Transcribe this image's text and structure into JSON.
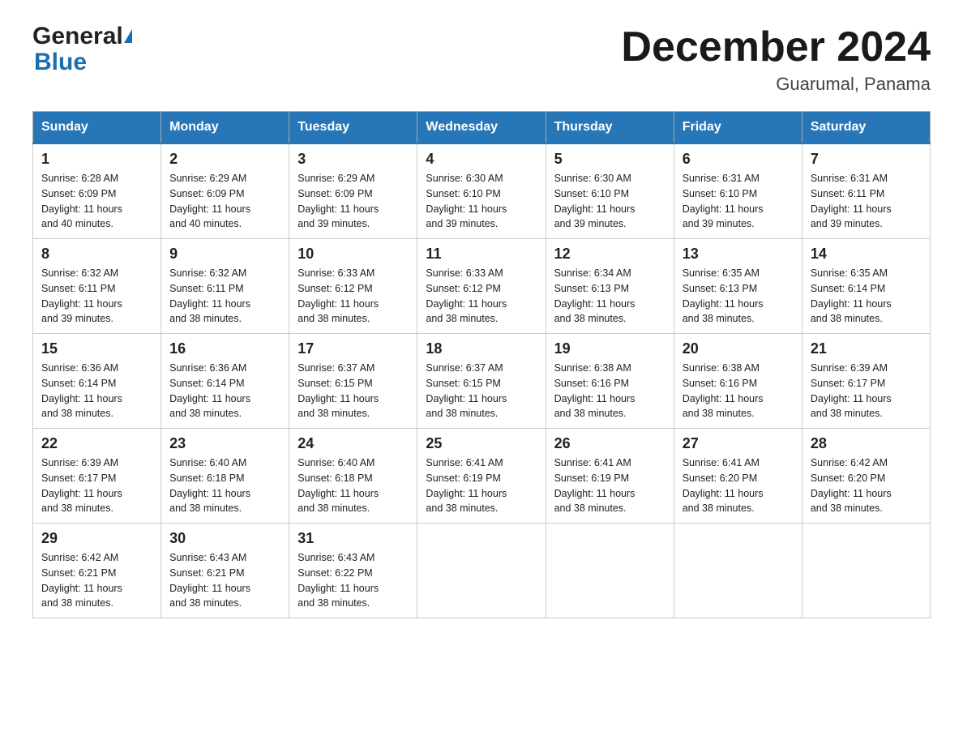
{
  "header": {
    "title": "December 2024",
    "subtitle": "Guarumal, Panama",
    "logo_general": "General",
    "logo_blue": "Blue"
  },
  "days_of_week": [
    "Sunday",
    "Monday",
    "Tuesday",
    "Wednesday",
    "Thursday",
    "Friday",
    "Saturday"
  ],
  "weeks": [
    [
      {
        "day": "1",
        "sunrise": "6:28 AM",
        "sunset": "6:09 PM",
        "daylight": "11 hours and 40 minutes."
      },
      {
        "day": "2",
        "sunrise": "6:29 AM",
        "sunset": "6:09 PM",
        "daylight": "11 hours and 40 minutes."
      },
      {
        "day": "3",
        "sunrise": "6:29 AM",
        "sunset": "6:09 PM",
        "daylight": "11 hours and 39 minutes."
      },
      {
        "day": "4",
        "sunrise": "6:30 AM",
        "sunset": "6:10 PM",
        "daylight": "11 hours and 39 minutes."
      },
      {
        "day": "5",
        "sunrise": "6:30 AM",
        "sunset": "6:10 PM",
        "daylight": "11 hours and 39 minutes."
      },
      {
        "day": "6",
        "sunrise": "6:31 AM",
        "sunset": "6:10 PM",
        "daylight": "11 hours and 39 minutes."
      },
      {
        "day": "7",
        "sunrise": "6:31 AM",
        "sunset": "6:11 PM",
        "daylight": "11 hours and 39 minutes."
      }
    ],
    [
      {
        "day": "8",
        "sunrise": "6:32 AM",
        "sunset": "6:11 PM",
        "daylight": "11 hours and 39 minutes."
      },
      {
        "day": "9",
        "sunrise": "6:32 AM",
        "sunset": "6:11 PM",
        "daylight": "11 hours and 38 minutes."
      },
      {
        "day": "10",
        "sunrise": "6:33 AM",
        "sunset": "6:12 PM",
        "daylight": "11 hours and 38 minutes."
      },
      {
        "day": "11",
        "sunrise": "6:33 AM",
        "sunset": "6:12 PM",
        "daylight": "11 hours and 38 minutes."
      },
      {
        "day": "12",
        "sunrise": "6:34 AM",
        "sunset": "6:13 PM",
        "daylight": "11 hours and 38 minutes."
      },
      {
        "day": "13",
        "sunrise": "6:35 AM",
        "sunset": "6:13 PM",
        "daylight": "11 hours and 38 minutes."
      },
      {
        "day": "14",
        "sunrise": "6:35 AM",
        "sunset": "6:14 PM",
        "daylight": "11 hours and 38 minutes."
      }
    ],
    [
      {
        "day": "15",
        "sunrise": "6:36 AM",
        "sunset": "6:14 PM",
        "daylight": "11 hours and 38 minutes."
      },
      {
        "day": "16",
        "sunrise": "6:36 AM",
        "sunset": "6:14 PM",
        "daylight": "11 hours and 38 minutes."
      },
      {
        "day": "17",
        "sunrise": "6:37 AM",
        "sunset": "6:15 PM",
        "daylight": "11 hours and 38 minutes."
      },
      {
        "day": "18",
        "sunrise": "6:37 AM",
        "sunset": "6:15 PM",
        "daylight": "11 hours and 38 minutes."
      },
      {
        "day": "19",
        "sunrise": "6:38 AM",
        "sunset": "6:16 PM",
        "daylight": "11 hours and 38 minutes."
      },
      {
        "day": "20",
        "sunrise": "6:38 AM",
        "sunset": "6:16 PM",
        "daylight": "11 hours and 38 minutes."
      },
      {
        "day": "21",
        "sunrise": "6:39 AM",
        "sunset": "6:17 PM",
        "daylight": "11 hours and 38 minutes."
      }
    ],
    [
      {
        "day": "22",
        "sunrise": "6:39 AM",
        "sunset": "6:17 PM",
        "daylight": "11 hours and 38 minutes."
      },
      {
        "day": "23",
        "sunrise": "6:40 AM",
        "sunset": "6:18 PM",
        "daylight": "11 hours and 38 minutes."
      },
      {
        "day": "24",
        "sunrise": "6:40 AM",
        "sunset": "6:18 PM",
        "daylight": "11 hours and 38 minutes."
      },
      {
        "day": "25",
        "sunrise": "6:41 AM",
        "sunset": "6:19 PM",
        "daylight": "11 hours and 38 minutes."
      },
      {
        "day": "26",
        "sunrise": "6:41 AM",
        "sunset": "6:19 PM",
        "daylight": "11 hours and 38 minutes."
      },
      {
        "day": "27",
        "sunrise": "6:41 AM",
        "sunset": "6:20 PM",
        "daylight": "11 hours and 38 minutes."
      },
      {
        "day": "28",
        "sunrise": "6:42 AM",
        "sunset": "6:20 PM",
        "daylight": "11 hours and 38 minutes."
      }
    ],
    [
      {
        "day": "29",
        "sunrise": "6:42 AM",
        "sunset": "6:21 PM",
        "daylight": "11 hours and 38 minutes."
      },
      {
        "day": "30",
        "sunrise": "6:43 AM",
        "sunset": "6:21 PM",
        "daylight": "11 hours and 38 minutes."
      },
      {
        "day": "31",
        "sunrise": "6:43 AM",
        "sunset": "6:22 PM",
        "daylight": "11 hours and 38 minutes."
      },
      null,
      null,
      null,
      null
    ]
  ],
  "labels": {
    "sunrise": "Sunrise:",
    "sunset": "Sunset:",
    "daylight": "Daylight:"
  }
}
